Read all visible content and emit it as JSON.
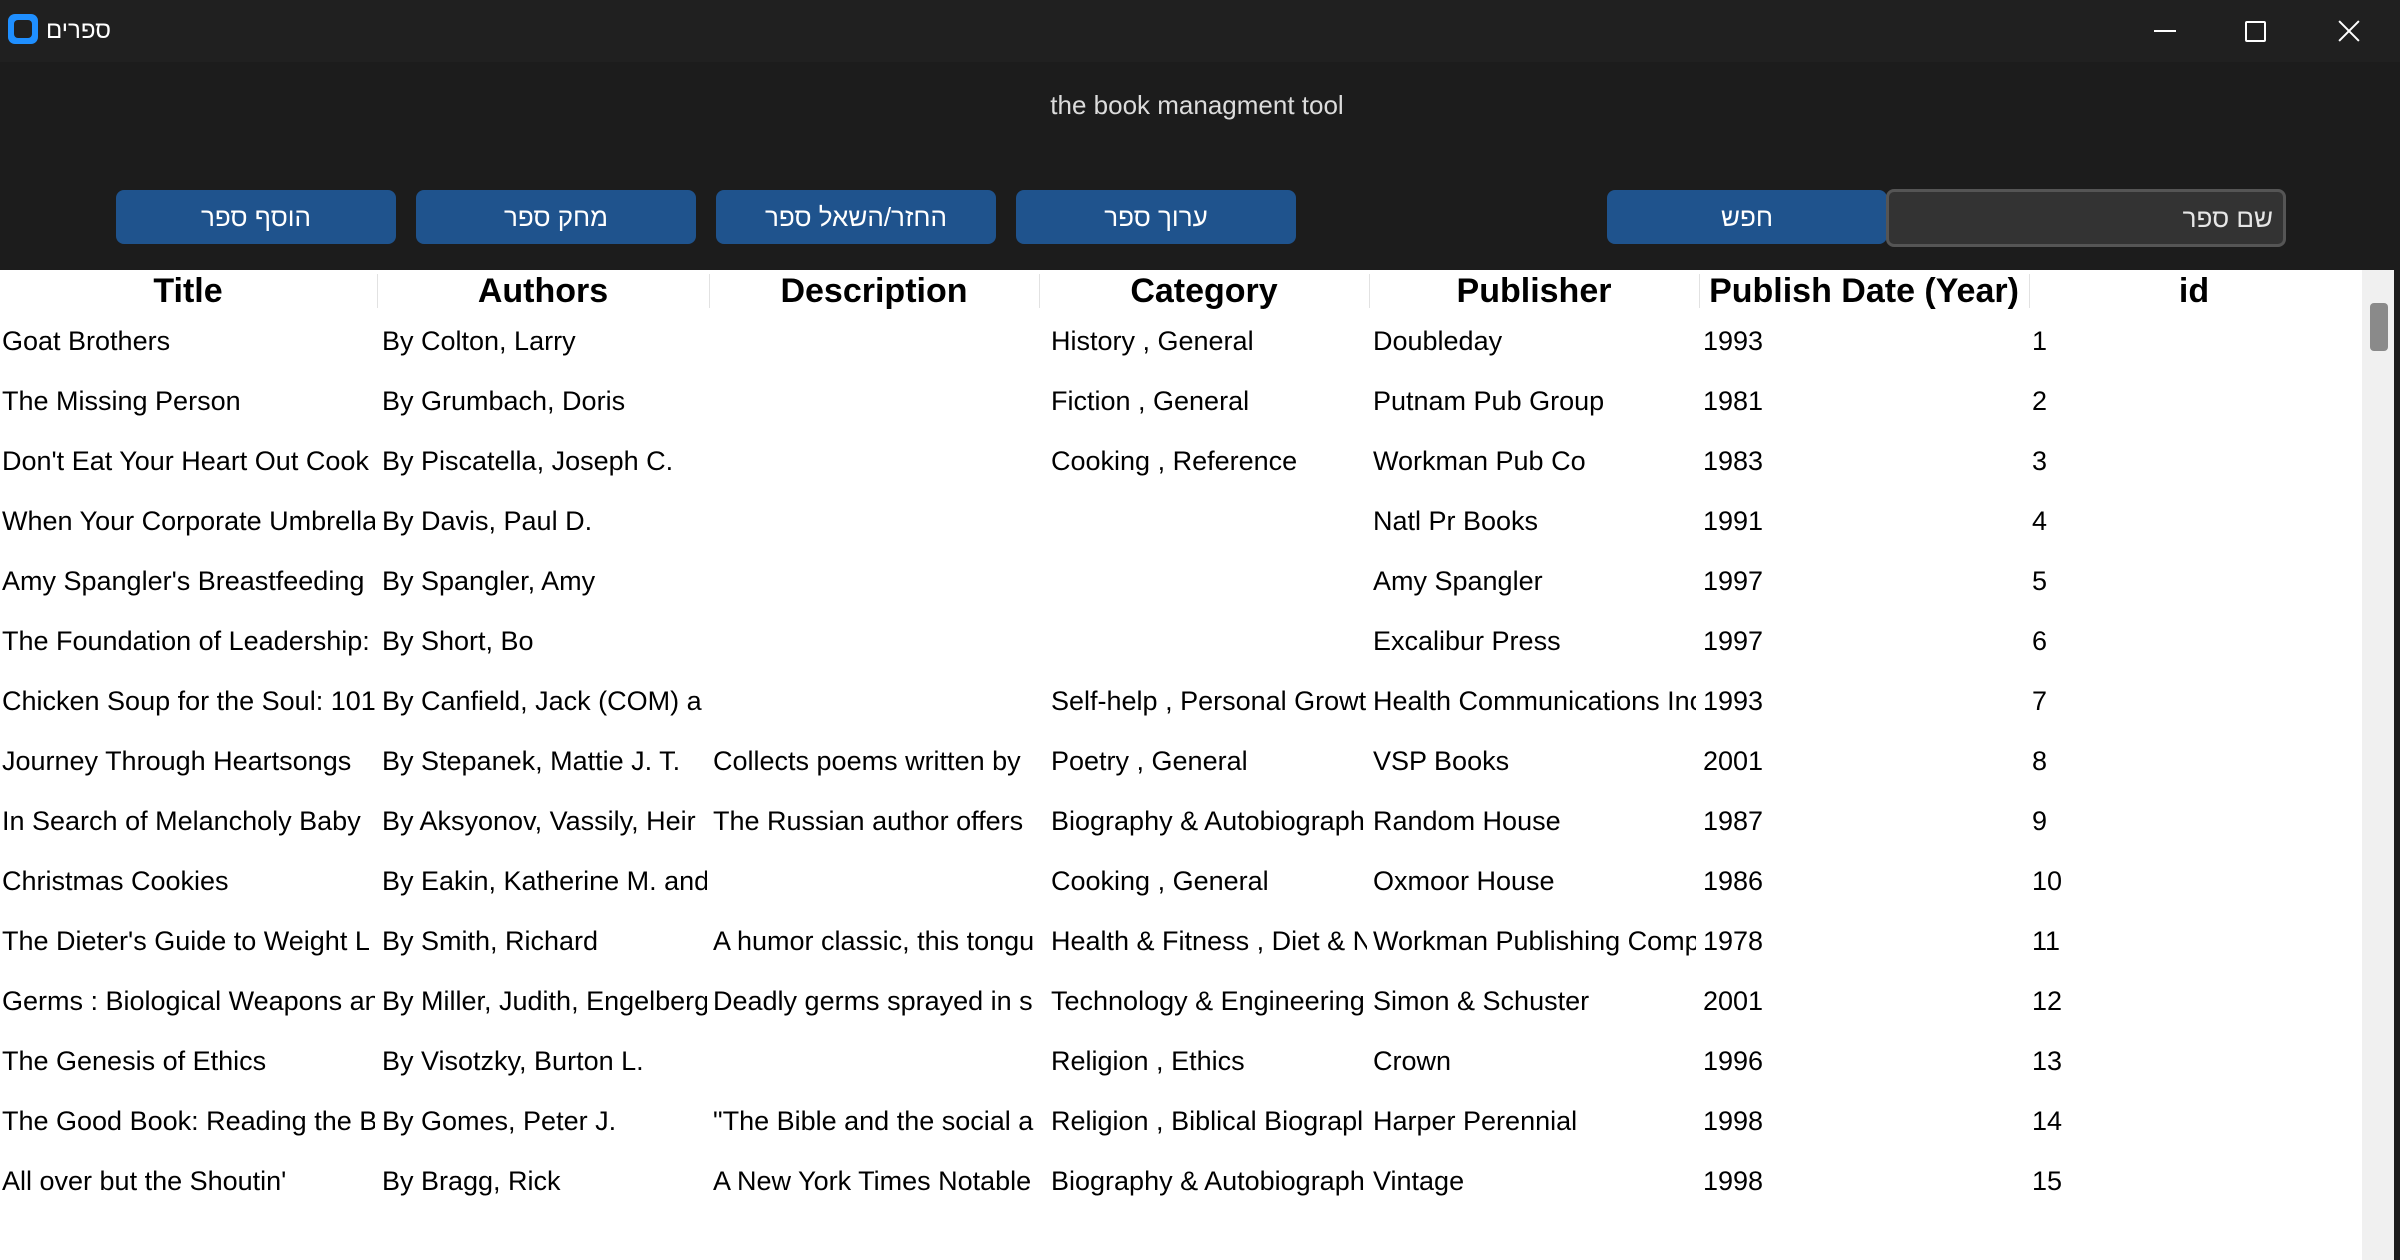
{
  "window": {
    "title": "ספרים",
    "subtitle": "the book managment tool"
  },
  "toolbar": {
    "add_label": "הוסף ספר",
    "delete_label": "מחק ספר",
    "return_label": "החזר/השאל ספר",
    "edit_label": "ערוך ספר",
    "search_label": "חפש",
    "search_placeholder": "שם ספר"
  },
  "table": {
    "headers": [
      "Title",
      "Authors",
      "Description",
      "Category",
      "Publisher",
      "Publish Date (Year)",
      "id"
    ],
    "rows": [
      [
        "Goat Brothers",
        "By Colton, Larry",
        "",
        "History , General",
        "Doubleday",
        "1993",
        "1"
      ],
      [
        "The Missing Person",
        "By Grumbach, Doris",
        "",
        "Fiction , General",
        "Putnam Pub Group",
        "1981",
        "2"
      ],
      [
        "Don't Eat Your Heart Out Cook",
        "By Piscatella, Joseph C.",
        "",
        "Cooking , Reference",
        "Workman Pub Co",
        "1983",
        "3"
      ],
      [
        "When Your Corporate Umbrella",
        "By Davis, Paul D.",
        "",
        "",
        "Natl Pr Books",
        "1991",
        "4"
      ],
      [
        "Amy Spangler's Breastfeeding",
        "By Spangler, Amy",
        "",
        "",
        "Amy Spangler",
        "1997",
        "5"
      ],
      [
        "The Foundation of Leadership:",
        "By Short, Bo",
        "",
        "",
        "Excalibur Press",
        "1997",
        "6"
      ],
      [
        "Chicken Soup for the Soul: 101",
        "By Canfield, Jack (COM) a",
        "",
        "Self-help , Personal Growt",
        "Health Communications Inc",
        "1993",
        "7"
      ],
      [
        "Journey Through Heartsongs",
        "By Stepanek, Mattie J. T.",
        "Collects poems written by",
        "Poetry , General",
        "VSP Books",
        "2001",
        "8"
      ],
      [
        "In Search of Melancholy Baby",
        "By Aksyonov, Vassily, Heir",
        "The Russian author offers",
        "Biography & Autobiograph",
        "Random House",
        "1987",
        "9"
      ],
      [
        "Christmas Cookies",
        "By Eakin, Katherine M. and",
        "",
        "Cooking , General",
        "Oxmoor House",
        "1986",
        "10"
      ],
      [
        "The Dieter's Guide to Weight L",
        "By Smith, Richard",
        "A humor classic, this tongu",
        "Health & Fitness , Diet & N",
        "Workman Publishing Comp",
        "1978",
        "11"
      ],
      [
        "Germs : Biological Weapons an",
        "By Miller, Judith, Engelberg",
        "Deadly germs sprayed in s",
        "Technology & Engineering",
        "Simon & Schuster",
        "2001",
        "12"
      ],
      [
        "The Genesis of Ethics",
        "By Visotzky, Burton L.",
        "",
        "Religion , Ethics",
        "Crown",
        "1996",
        "13"
      ],
      [
        "The Good Book: Reading the B",
        "By Gomes, Peter J.",
        "\"The Bible and the social a",
        "Religion , Biblical Biograpl",
        "Harper Perennial",
        "1998",
        "14"
      ],
      [
        "All over but the Shoutin'",
        "By Bragg, Rick",
        "A New York Times Notable",
        "Biography & Autobiograph",
        "Vintage",
        "1998",
        "15"
      ]
    ]
  },
  "scrollbar": {
    "position_fraction": 0.0
  }
}
